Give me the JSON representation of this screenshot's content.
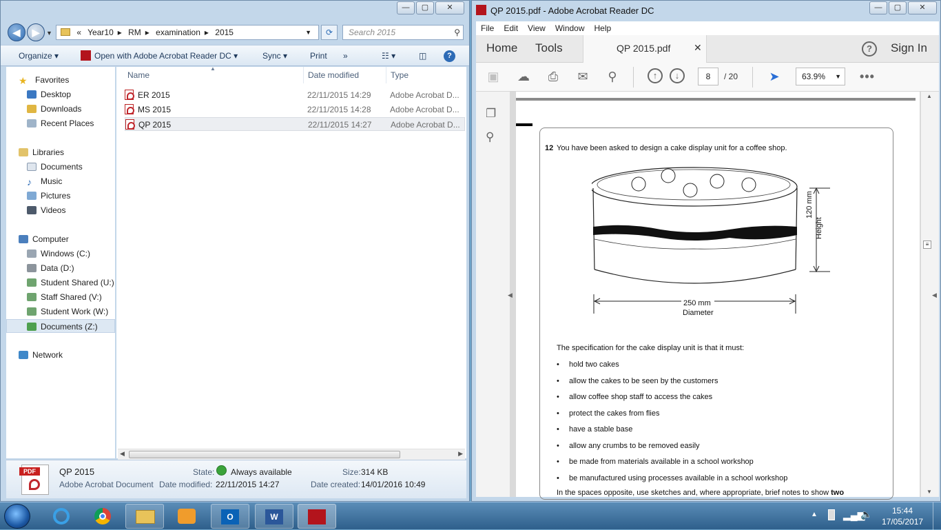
{
  "explorer": {
    "address_parts": [
      "«",
      "Year10",
      "RM",
      "examination",
      "2015"
    ],
    "search_placeholder": "Search 2015",
    "toolbar": {
      "organize": "Organize",
      "open_with": "Open with Adobe Acrobat Reader DC",
      "sync": "Sync",
      "print": "Print",
      "more": "»"
    },
    "nav": {
      "favorites": "Favorites",
      "desktop": "Desktop",
      "downloads": "Downloads",
      "recent": "Recent Places",
      "libraries": "Libraries",
      "documents": "Documents",
      "music": "Music",
      "pictures": "Pictures",
      "videos": "Videos",
      "computer": "Computer",
      "drive_c": "Windows (C:)",
      "drive_d": "Data (D:)",
      "drive_u": "Student Shared (U:)",
      "drive_v": "Staff Shared (V:)",
      "drive_w": "Student Work (W:)",
      "drive_z": "Documents (Z:)",
      "network": "Network"
    },
    "columns": {
      "name": "Name",
      "date": "Date modified",
      "type": "Type"
    },
    "files": [
      {
        "name": "ER 2015",
        "date": "22/11/2015 14:29",
        "type": "Adobe Acrobat D..."
      },
      {
        "name": "MS 2015",
        "date": "22/11/2015 14:28",
        "type": "Adobe Acrobat D..."
      },
      {
        "name": "QP 2015",
        "date": "22/11/2015 14:27",
        "type": "Adobe Acrobat D..."
      }
    ],
    "details": {
      "icon_label": "PDF",
      "name": "QP 2015",
      "kind": "Adobe Acrobat Document",
      "state_label": "State:",
      "state_value": "Always available",
      "size_label": "Size:",
      "size_value": "314 KB",
      "modified_label": "Date modified:",
      "modified_value": "22/11/2015 14:27",
      "created_label": "Date created:",
      "created_value": "14/01/2016 10:49"
    }
  },
  "acrobat": {
    "title": "QP 2015.pdf - Adobe Acrobat Reader DC",
    "menu": [
      "File",
      "Edit",
      "View",
      "Window",
      "Help"
    ],
    "home_tab": "Home",
    "tools_tab": "Tools",
    "doc_tab": "QP 2015.pdf",
    "sign_in": "Sign In",
    "page_current": "8",
    "page_total": "/ 20",
    "zoom": "63.9%",
    "doc": {
      "q_number": "12",
      "q_text": "You have been asked to design a cake display unit for a coffee shop.",
      "height_value": "120 mm",
      "height_label": "Height",
      "diameter_value": "250 mm",
      "diameter_label": "Diameter",
      "spec_intro": "The specification for the cake display unit is that it must:",
      "bullets": [
        "hold two cakes",
        "allow the cakes to be seen by the customers",
        "allow coffee shop staff to access the cakes",
        "protect the cakes from flies",
        "have a stable base",
        "allow any crumbs to be removed easily",
        "be made from materials available in a school workshop",
        "be manufactured using processes available in a school workshop"
      ],
      "footer_text": "In the spaces opposite, use sketches and, where appropriate, brief notes to show",
      "footer_bold": "two"
    }
  },
  "taskbar": {
    "time": "15:44",
    "date": "17/05/2017"
  }
}
